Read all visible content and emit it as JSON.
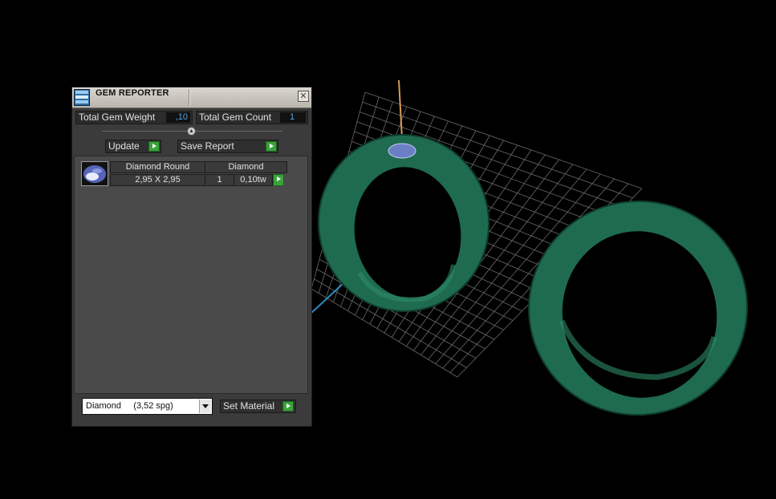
{
  "window": {
    "title": "GEM REPORTER"
  },
  "summary": {
    "total_weight_label": "Total Gem Weight",
    "total_weight_value": ",10",
    "total_count_label": "Total Gem Count",
    "total_count_value": "1"
  },
  "actions": {
    "update_label": "Update",
    "save_label": "Save Report"
  },
  "gems": [
    {
      "shape": "Diamond Round",
      "material": "Diamond",
      "size": "2,95 X 2,95",
      "count": "1",
      "weight": "0,10tw"
    }
  ],
  "material_select": {
    "selected": "Diamond     (3,52 spg)"
  },
  "set_material_label": "Set Material",
  "colors": {
    "ring_green": "#1f6b4f",
    "gem_blue": "#6b7fc4",
    "arrow_green": "#39a33a",
    "value_blue": "#5aa8e8"
  },
  "icons": {
    "app": "gem-reporter-icon",
    "close": "close-icon",
    "arrow": "play-arrow-icon",
    "collapse": "collapse-knob-icon",
    "dropdown": "chevron-down-icon"
  }
}
